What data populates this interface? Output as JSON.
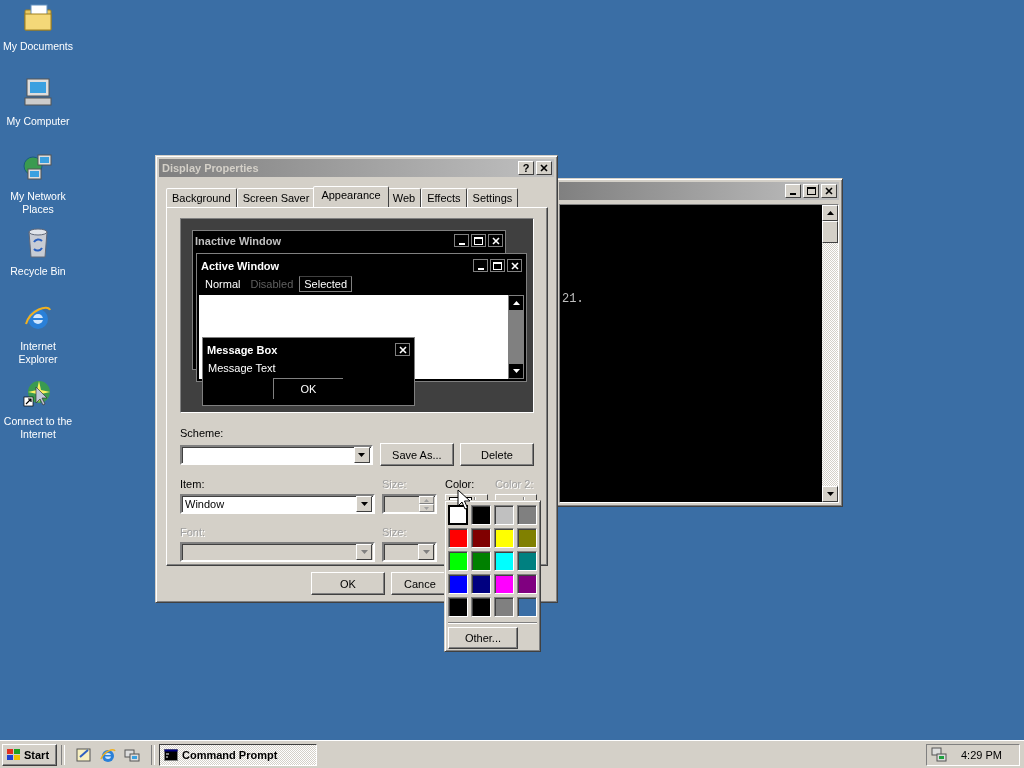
{
  "desktop_icons": [
    {
      "label": "My Documents",
      "kind": "documents"
    },
    {
      "label": "My Computer",
      "kind": "computer"
    },
    {
      "label": "My Network Places",
      "kind": "network"
    },
    {
      "label": "Recycle Bin",
      "kind": "recycle"
    },
    {
      "label": "Internet Explorer",
      "kind": "browser"
    },
    {
      "label": "Connect to the Internet",
      "kind": "connect"
    }
  ],
  "console_window": {
    "text": "21."
  },
  "dialog": {
    "title": "Display Properties",
    "help_button": "?",
    "tabs": [
      {
        "label": "Background",
        "selected": false
      },
      {
        "label": "Screen Saver",
        "selected": false
      },
      {
        "label": "Appearance",
        "selected": true
      },
      {
        "label": "Web",
        "selected": false
      },
      {
        "label": "Effects",
        "selected": false
      },
      {
        "label": "Settings",
        "selected": false
      }
    ],
    "preview": {
      "inactive_title": "Inactive Window",
      "active_title": "Active Window",
      "menu": [
        {
          "label": "Normal",
          "disabled": false,
          "selected": false
        },
        {
          "label": "Disabled",
          "disabled": true,
          "selected": false
        },
        {
          "label": "Selected",
          "disabled": false,
          "selected": true
        }
      ],
      "message_box": {
        "title": "Message Box",
        "text": "Message Text",
        "button": "OK"
      }
    },
    "scheme": {
      "label": "Scheme:",
      "buttons": [
        "Save As...",
        "Delete"
      ]
    },
    "fields": [
      {
        "label": "Item:",
        "kind": "combo",
        "value": "Window",
        "disabled": false
      },
      {
        "label": "Size:",
        "kind": "spinner",
        "disabled": true
      },
      {
        "label": "Color:",
        "kind": "color",
        "disabled": false
      },
      {
        "label": "Color 2:",
        "kind": "color",
        "disabled": true
      },
      {
        "label": "Font:",
        "kind": "combo",
        "disabled": true
      },
      {
        "label": "Size:",
        "kind": "combo",
        "disabled": true
      }
    ],
    "buttons": [
      "OK",
      "Cance"
    ]
  },
  "color_picker": {
    "swatches": [
      {
        "color": "#ffffff",
        "selected": true
      },
      {
        "color": "#000000",
        "selected": false
      },
      {
        "color": "#c0c0c0",
        "selected": false
      },
      {
        "color": "#808080",
        "selected": false
      },
      {
        "color": "#ff0000",
        "selected": false
      },
      {
        "color": "#800000",
        "selected": false
      },
      {
        "color": "#ffff00",
        "selected": false
      },
      {
        "color": "#808000",
        "selected": false
      },
      {
        "color": "#00ff00",
        "selected": false
      },
      {
        "color": "#008000",
        "selected": false
      },
      {
        "color": "#00ffff",
        "selected": false
      },
      {
        "color": "#008080",
        "selected": false
      },
      {
        "color": "#0000ff",
        "selected": false
      },
      {
        "color": "#000080",
        "selected": false
      },
      {
        "color": "#ff00ff",
        "selected": false
      },
      {
        "color": "#800080",
        "selected": false
      },
      {
        "color": "#000000",
        "selected": false
      },
      {
        "color": "#000000",
        "selected": false
      },
      {
        "color": "#808080",
        "selected": false
      },
      {
        "color": "#3a6ea5",
        "selected": false
      }
    ],
    "other_button": "Other..."
  },
  "taskbar": {
    "start": "Start",
    "tasks": [
      {
        "label": "Command Prompt",
        "selected": true
      }
    ],
    "clock": "4:29 PM"
  }
}
